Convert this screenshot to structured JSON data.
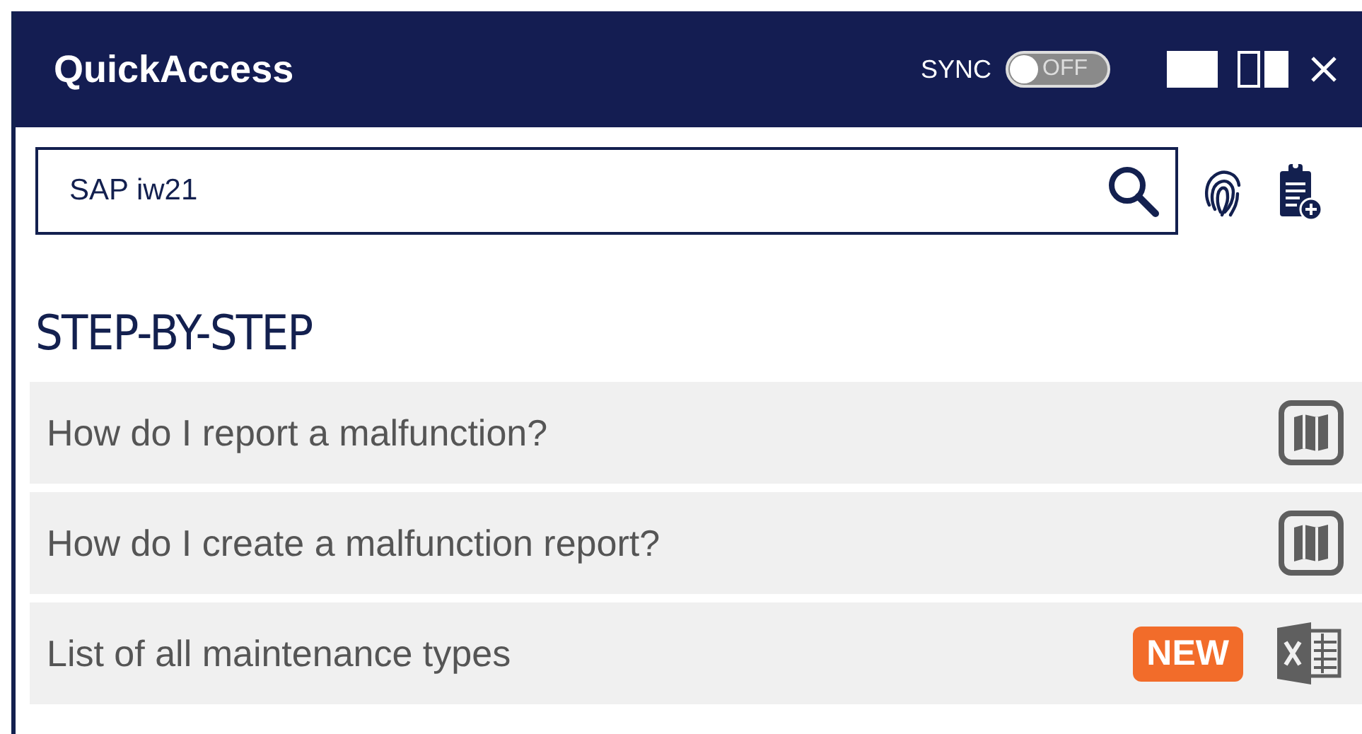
{
  "window": {
    "title": "QuickAccess"
  },
  "sync": {
    "label": "SYNC",
    "on": false,
    "state_text": "OFF"
  },
  "search": {
    "value": "SAP iw21"
  },
  "section": {
    "title": "STEP-BY-STEP"
  },
  "items": [
    {
      "label": "How do I report a malfunction?",
      "kind": "guide"
    },
    {
      "label": "How do I create a malfunction report?",
      "kind": "guide"
    },
    {
      "label": "List of all maintenance types",
      "kind": "excel",
      "badge": "NEW"
    }
  ]
}
